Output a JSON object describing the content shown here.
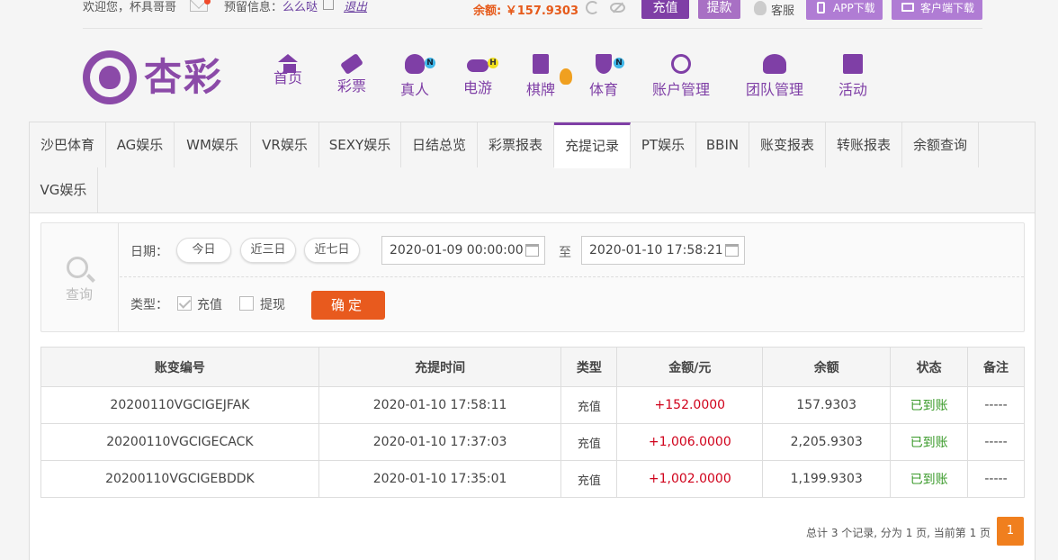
{
  "topbar": {
    "welcome_prefix": "欢迎您，",
    "username": "杯具哥哥",
    "reserve_label": "预留信息：",
    "reserve_value": "么么哒",
    "logout": "退出",
    "balance_label": "余额:",
    "balance_value": "￥157.9303",
    "recharge": "充值",
    "withdraw": "提款",
    "service": "客服",
    "app_download": "APP下载",
    "client_download": "客户端下载"
  },
  "brand": {
    "logo_text": "杏彩",
    "color": "#8b4aa8"
  },
  "nav": {
    "items": [
      {
        "label": "首页",
        "icon": "home-icon"
      },
      {
        "label": "彩票",
        "icon": "ticket-icon"
      },
      {
        "label": "真人",
        "icon": "live-dealer-icon",
        "badge": "N"
      },
      {
        "label": "电游",
        "icon": "gamepad-icon",
        "badge": "H"
      },
      {
        "label": "棋牌",
        "icon": "cards-icon"
      },
      {
        "label": "体育",
        "icon": "trophy-icon",
        "badge": "N"
      },
      {
        "label": "账户管理",
        "icon": "coin-icon"
      },
      {
        "label": "团队管理",
        "icon": "team-icon"
      },
      {
        "label": "活动",
        "icon": "gift-icon"
      }
    ]
  },
  "tabs": [
    "沙巴体育",
    "AG娱乐",
    "WM娱乐",
    "VR娱乐",
    "SEXY娱乐",
    "日结总览",
    "彩票报表",
    "充提记录",
    "PT娱乐",
    "BBIN",
    "账变报表",
    "转账报表",
    "余额查询",
    "VG娱乐"
  ],
  "active_tab": "充提记录",
  "query": {
    "title": "查询",
    "date_label": "日期：",
    "quick": [
      "今日",
      "近三日",
      "近七日"
    ],
    "start": "2020-01-09 00:00:00",
    "to": "至",
    "end": "2020-01-10 17:58:21",
    "type_label": "类型：",
    "type_recharge": "充值",
    "type_recharge_checked": true,
    "type_withdraw": "提现",
    "type_withdraw_checked": false,
    "confirm": "确定"
  },
  "table": {
    "headers": [
      "账变编号",
      "充提时间",
      "类型",
      "金额/元",
      "余额",
      "状态",
      "备注"
    ],
    "rows": [
      [
        "20200110VGCIGEJFAK",
        "2020-01-10 17:58:11",
        "充值",
        "+152.0000",
        "157.9303",
        "已到账",
        "-----"
      ],
      [
        "20200110VGCIGECACK",
        "2020-01-10 17:37:03",
        "充值",
        "+1,006.0000",
        "2,205.9303",
        "已到账",
        "-----"
      ],
      [
        "20200110VGCIGEBDDK",
        "2020-01-10 17:35:01",
        "充值",
        "+1,002.0000",
        "1,199.9303",
        "已到账",
        "-----"
      ]
    ]
  },
  "pager": {
    "info": "总计 3 个记录, 分为 1 页, 当前第 1 页",
    "current": "1"
  },
  "colors": {
    "purple": "#7f3fa6",
    "orange": "#e85a1e",
    "amount_red": "#d0021b",
    "status_green": "#3a9a2a"
  }
}
